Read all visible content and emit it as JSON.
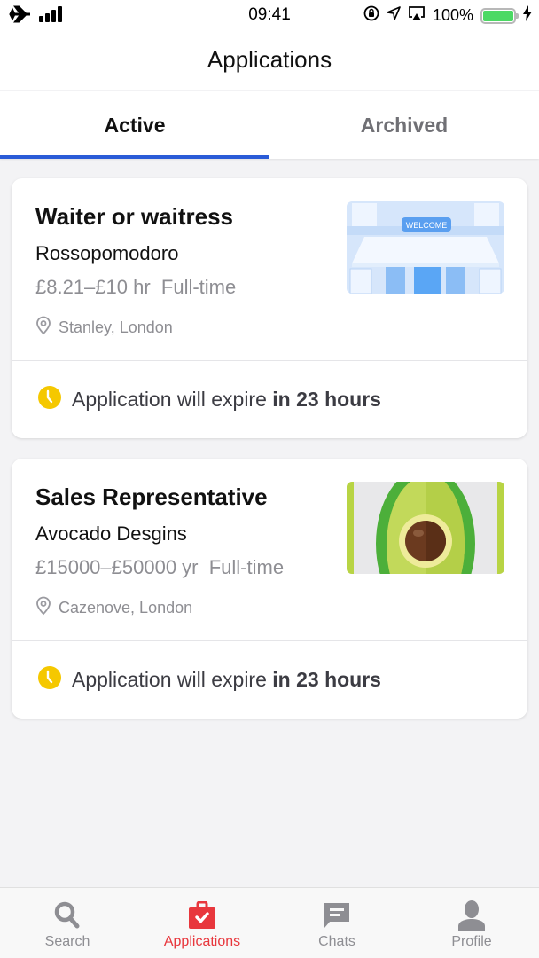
{
  "status_bar": {
    "time": "09:41",
    "battery": "100%",
    "battery_level": 1.0
  },
  "header": {
    "title": "Applications"
  },
  "tabs": [
    {
      "label": "Active",
      "active": true
    },
    {
      "label": "Archived",
      "active": false
    }
  ],
  "applications": [
    {
      "title": "Waiter or waitress",
      "company": "Rossopomodoro",
      "salary": "£8.21–£10 hr",
      "type": "Full-time",
      "location": "Stanley, London",
      "image": "shopfront-welcome",
      "expiry_prefix": "Application will expire ",
      "expiry_time": "in 23 hours"
    },
    {
      "title": "Sales Representative",
      "company": "Avocado Desgins",
      "salary": "£15000–£50000 yr",
      "type": "Full-time",
      "location": "Cazenove, London",
      "image": "avocado",
      "expiry_prefix": "Application will expire ",
      "expiry_time": "in 23 hours"
    }
  ],
  "tab_bar": {
    "items": [
      {
        "label": "Search",
        "icon": "search-icon",
        "active": false
      },
      {
        "label": "Applications",
        "icon": "briefcase-check-icon",
        "active": true
      },
      {
        "label": "Chats",
        "icon": "chat-icon",
        "active": false
      },
      {
        "label": "Profile",
        "icon": "person-icon",
        "active": false
      }
    ]
  },
  "colors": {
    "accent_tab": "#2a5bd7",
    "active_nav": "#e8373d",
    "clock": "#f5c800",
    "battery": "#4cd964"
  }
}
